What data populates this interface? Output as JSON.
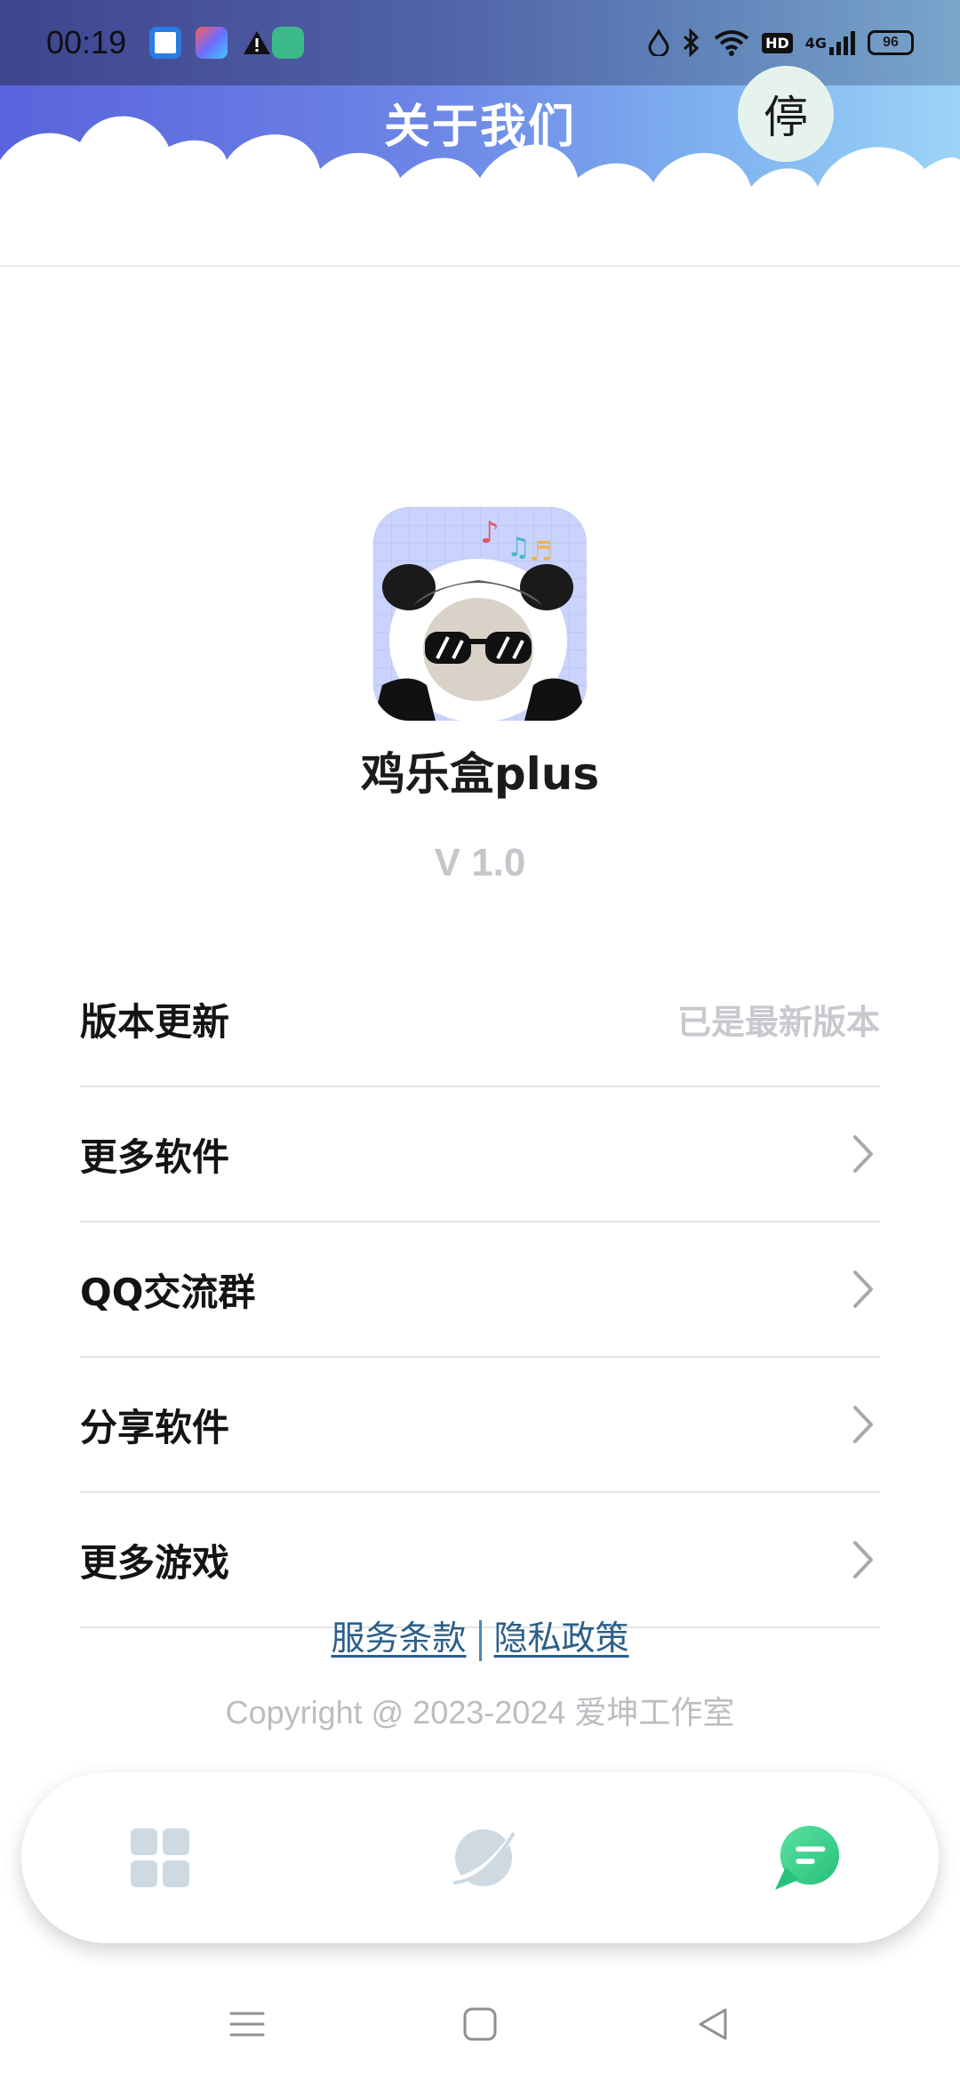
{
  "status_bar": {
    "time": "00:19",
    "battery": "96",
    "network": "4G",
    "hd_badge": "HD"
  },
  "header": {
    "title": "关于我们",
    "stop_button_label": "停"
  },
  "app": {
    "name": "鸡乐盒plus",
    "version": "V 1.0"
  },
  "menu": {
    "items": [
      {
        "label": "版本更新",
        "value": "已是最新版本"
      },
      {
        "label": "更多软件"
      },
      {
        "label": "QQ交流群"
      },
      {
        "label": "分享软件"
      },
      {
        "label": "更多游戏"
      }
    ]
  },
  "links": {
    "terms": "服务条款",
    "privacy": "隐私政策"
  },
  "footer": {
    "copyright": "Copyright @ 2023-2024 爱坤工作室"
  },
  "tabbar": {
    "tabs": [
      {
        "icon": "grid-icon",
        "active": false
      },
      {
        "icon": "planet-icon",
        "active": false
      },
      {
        "icon": "chat-icon",
        "active": true
      }
    ]
  },
  "colors": {
    "header_gradient_start": "#5a63dc",
    "header_gradient_end": "#9cd4f7",
    "active_tab": "#3fcf8e",
    "inactive_tab": "#cfd9e1",
    "link": "#2b5f8a"
  }
}
